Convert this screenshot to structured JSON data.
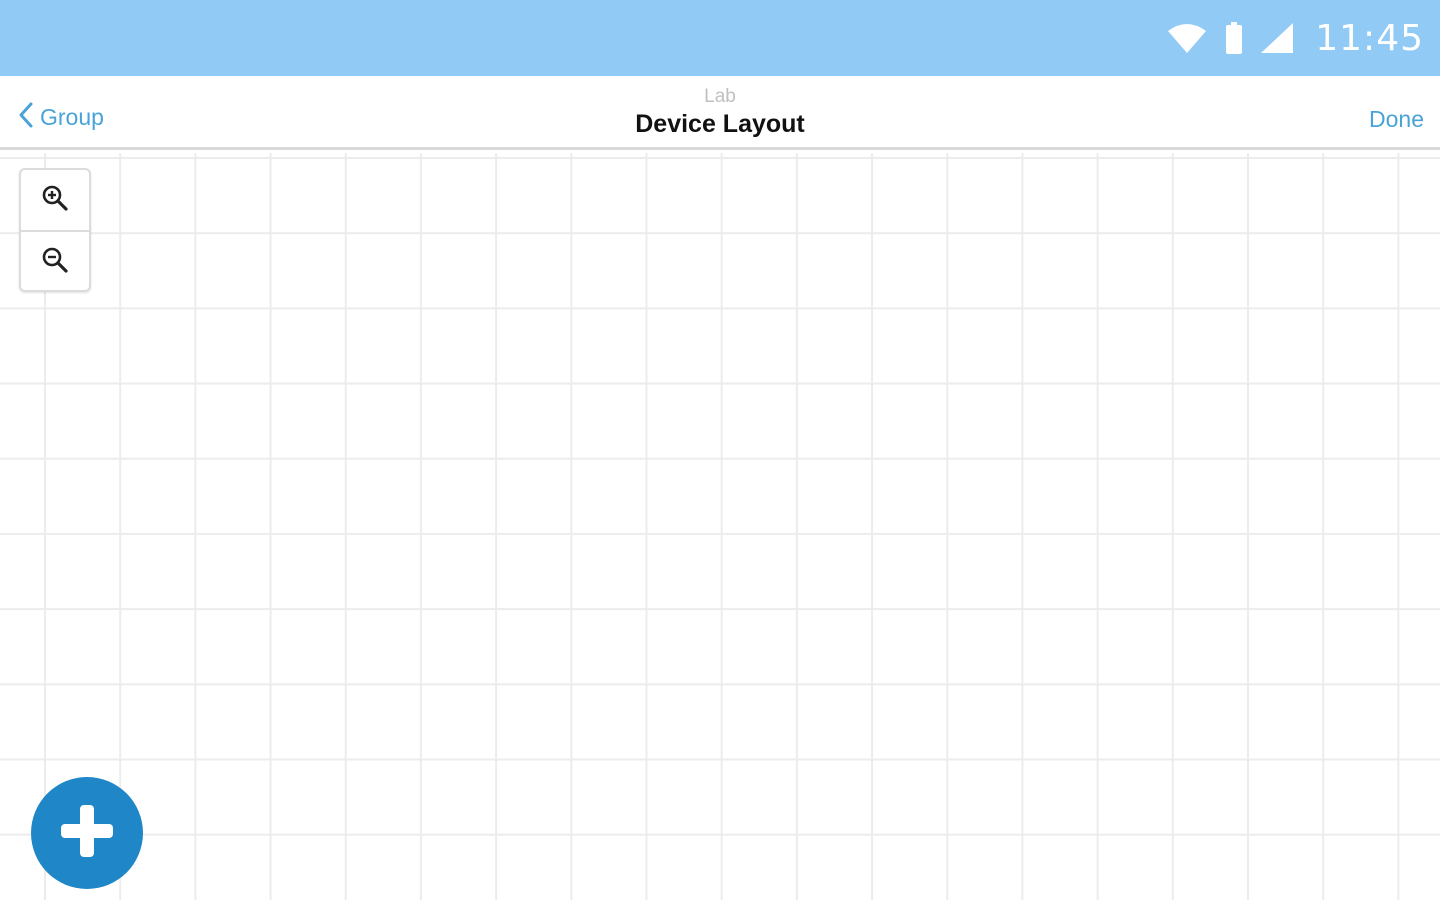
{
  "status_bar": {
    "time": "11:45",
    "color": "#90caf5",
    "icons": [
      "wifi-icon",
      "battery-icon",
      "cellular-signal-icon"
    ]
  },
  "nav": {
    "back_label": "Group",
    "subtitle": "Lab",
    "title": "Device Layout",
    "done_label": "Done",
    "accent_color": "#4aa3d8"
  },
  "canvas": {
    "grid": true,
    "zoom_controls": [
      "zoom-in-icon",
      "zoom-out-icon"
    ]
  },
  "fab": {
    "icon": "plus-icon",
    "color": "#1f86c8"
  }
}
